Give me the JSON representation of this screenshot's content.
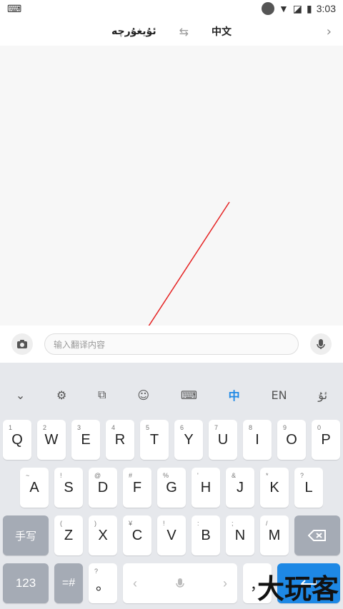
{
  "status": {
    "time": "3:03"
  },
  "header": {
    "source_lang": "ئۇيغۇرچە",
    "target_lang": "中文"
  },
  "input": {
    "placeholder": "输入翻译内容"
  },
  "toolbar": {
    "lang_cn": "中",
    "lang_en": "EN",
    "lang_ug": "ئۇ"
  },
  "keyboard": {
    "row1": [
      {
        "sup": "1",
        "main": "Q"
      },
      {
        "sup": "2",
        "main": "W"
      },
      {
        "sup": "3",
        "main": "E"
      },
      {
        "sup": "4",
        "main": "R"
      },
      {
        "sup": "5",
        "main": "T"
      },
      {
        "sup": "6",
        "main": "Y"
      },
      {
        "sup": "7",
        "main": "U"
      },
      {
        "sup": "8",
        "main": "I"
      },
      {
        "sup": "9",
        "main": "O"
      },
      {
        "sup": "0",
        "main": "P"
      }
    ],
    "row2": [
      {
        "sup": "~",
        "main": "A"
      },
      {
        "sup": "!",
        "main": "S"
      },
      {
        "sup": "@",
        "main": "D"
      },
      {
        "sup": "#",
        "main": "F"
      },
      {
        "sup": "%",
        "main": "G"
      },
      {
        "sup": "'",
        "main": "H"
      },
      {
        "sup": "&",
        "main": "J"
      },
      {
        "sup": "*",
        "main": "K"
      },
      {
        "sup": "?",
        "main": "L"
      }
    ],
    "row3": [
      {
        "sup": "(",
        "main": "Z"
      },
      {
        "sup": ")",
        "main": "X"
      },
      {
        "sup": "¥",
        "main": "C"
      },
      {
        "sup": "!",
        "main": "V"
      },
      {
        "sup": ":",
        "main": "B"
      },
      {
        "sup": ";",
        "main": "N"
      },
      {
        "sup": "/",
        "main": "M"
      }
    ],
    "handwrite": "手写",
    "num": "123",
    "sym": "=#",
    "period_sup": "?",
    "period": "。",
    "space_left": "‹",
    "space_right": "›",
    "comma": "，"
  },
  "watermark": "大玩客"
}
